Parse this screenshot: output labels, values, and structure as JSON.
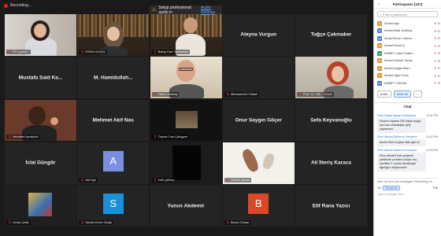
{
  "topbar": {
    "recording_label": "Recording..."
  },
  "banner": {
    "text": "Setup professional audio in",
    "link": "Audio Settings"
  },
  "tiles": [
    {
      "type": "video",
      "scene": "woman1",
      "label": "FP Ljudmi..."
    },
    {
      "type": "video",
      "scene": "hijab",
      "label": "ESRA ÜÇGÜL"
    },
    {
      "type": "video",
      "scene": "shelfman",
      "label": "Batuş Can Yamamoto"
    },
    {
      "type": "name",
      "name": "Aleyna Vurgun"
    },
    {
      "type": "name",
      "name": "Tuğçe Çakmaker"
    },
    {
      "type": "name",
      "name": "Mustafa Said Ka..."
    },
    {
      "type": "name",
      "name": "M. Hamidullah..."
    },
    {
      "type": "video",
      "scene": "glassesman",
      "label": "Yalnız Gümüş"
    },
    {
      "type": "name",
      "name": "",
      "label": "Muhammed Yüksel"
    },
    {
      "type": "video",
      "scene": "redhair",
      "label": "Prof. Dr. Ülk... Güvel",
      "active": true
    },
    {
      "type": "video",
      "scene": "man_dark",
      "label": "Mustafa Karabulut"
    },
    {
      "type": "name",
      "name": "Mehmet Akif Nas"
    },
    {
      "type": "video",
      "scene": "photo",
      "label": "Toprak Can Çalışgan"
    },
    {
      "type": "name",
      "name": "Onur Saygın Göçer"
    },
    {
      "type": "name",
      "name": "Sefa Keyvanoğlu"
    },
    {
      "type": "name",
      "name": "İclal Güngör"
    },
    {
      "type": "avatar",
      "letter": "A",
      "color": "#7a8fe0",
      "label": "Arif Ayk"
    },
    {
      "type": "video",
      "scene": "blackframe",
      "label": "emir gürsoy"
    },
    {
      "type": "video",
      "scene": "artifacts",
      "label": "Yılmaz Ayhan"
    },
    {
      "type": "name",
      "name": "Ali İlteriş Karaca"
    },
    {
      "type": "video",
      "scene": "painting",
      "label": "Zehra Çelik"
    },
    {
      "type": "avatar",
      "letter": "S",
      "color": "#1b8fd8",
      "label": "Semih Emre Özalp"
    },
    {
      "type": "name",
      "name": "Yunus Akdemir"
    },
    {
      "type": "avatar",
      "letter": "B",
      "color": "#d8492a",
      "label": "Berna Özkan"
    },
    {
      "type": "name",
      "name": "Elif Rana Yazıcı"
    }
  ],
  "sidebar": {
    "title": "Participants (107)",
    "search_placeholder": "Find a participant",
    "participants": [
      {
        "initials": "AA",
        "name": "Ahmet Aşık",
        "color": "#e58e2d"
      },
      {
        "initials": "AB",
        "name": "Ahmet Bakir Ünlüsoy",
        "color": "#4a7be0"
      },
      {
        "initials": "AE",
        "name": "Ahmet Emre Yıldırım",
        "color": "#4a7be0"
      },
      {
        "initials": "AE",
        "name": "Ahmet Esrah Ş.",
        "color": "#e58e2d"
      },
      {
        "initials": "AC",
        "name": "AHMET Cahit Özdem.",
        "color": "#2d9b64"
      },
      {
        "initials": "AG",
        "name": "Ahmet Gürkan Tanas",
        "color": "#e58e2d"
      },
      {
        "initials": "AK",
        "name": "Ahmet Kağan Alam",
        "color": "#e58e2d"
      },
      {
        "initials": "AK",
        "name": "Ahmet Uğur Kılınç",
        "color": "#e58e2d"
      },
      {
        "initials": "AH",
        "name": "AHMET YÜKSAL",
        "color": "#4a7be0"
      }
    ],
    "btn_invite": "Invite",
    "btn_mute": "Mute All",
    "btn_more": "...",
    "chat_title": "Chat",
    "messages": [
      {
        "from": "From Hüsnü Şakar to Everyone",
        "time": "10:41 PM",
        "text": "Hocam toplantı 300 kişiye açığa için bazı arkadaşlar giriş yapamıyor"
      },
      {
        "from": "From Aleyna Şahan to Everyone",
        "time": "10:42 PM",
        "text": "benim filmi mi girse filan gibi mi"
      },
      {
        "from": "From Aleyna Şahan to Everyone",
        "time": "10:43 PM",
        "text": "Hem dersleri hem projeleri yürütmek problem oluyor mu, özellikle 3. sınıfın dersleriyle ağırlığını düşünürsek"
      }
    ],
    "recording_note": "Who can see your messages? Recording On",
    "to_label": "To:",
    "to_value": "Everyone",
    "file_label": "File",
    "input_placeholder": "Type message here..."
  }
}
